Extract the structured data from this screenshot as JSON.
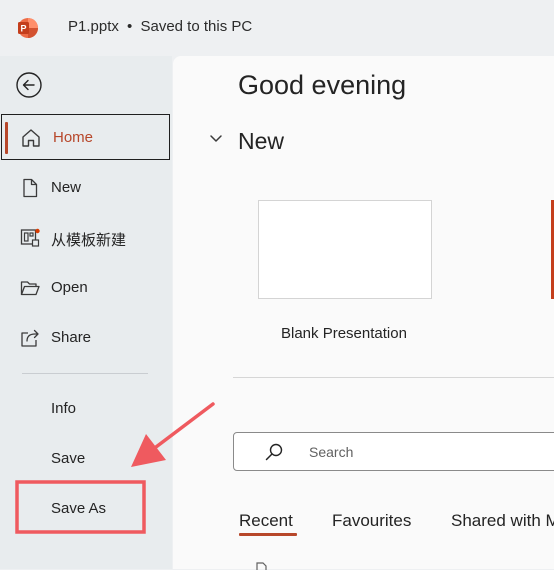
{
  "titlebar": {
    "document_title": "P1.pptx",
    "separator": "•",
    "save_status": "Saved to this PC"
  },
  "sidebar": {
    "items": [
      {
        "label": "Home",
        "icon": "home-icon"
      },
      {
        "label": "New",
        "icon": "new-document-icon"
      },
      {
        "label": "从模板新建",
        "icon": "template-icon"
      },
      {
        "label": "Open",
        "icon": "folder-open-icon"
      },
      {
        "label": "Share",
        "icon": "share-icon"
      }
    ],
    "secondary_items": [
      {
        "label": "Info"
      },
      {
        "label": "Save"
      },
      {
        "label": "Save As"
      }
    ]
  },
  "main": {
    "greeting": "Good evening",
    "new_section": {
      "heading": "New",
      "templates": [
        {
          "label": "Blank Presentation"
        }
      ]
    },
    "search": {
      "placeholder": "Search"
    },
    "tabs": [
      {
        "label": "Recent",
        "selected": true
      },
      {
        "label": "Favourites",
        "selected": false
      },
      {
        "label": "Shared with M",
        "selected": false
      }
    ]
  },
  "colors": {
    "accent": "#b7472a",
    "annotation": "#ef5a5f"
  }
}
